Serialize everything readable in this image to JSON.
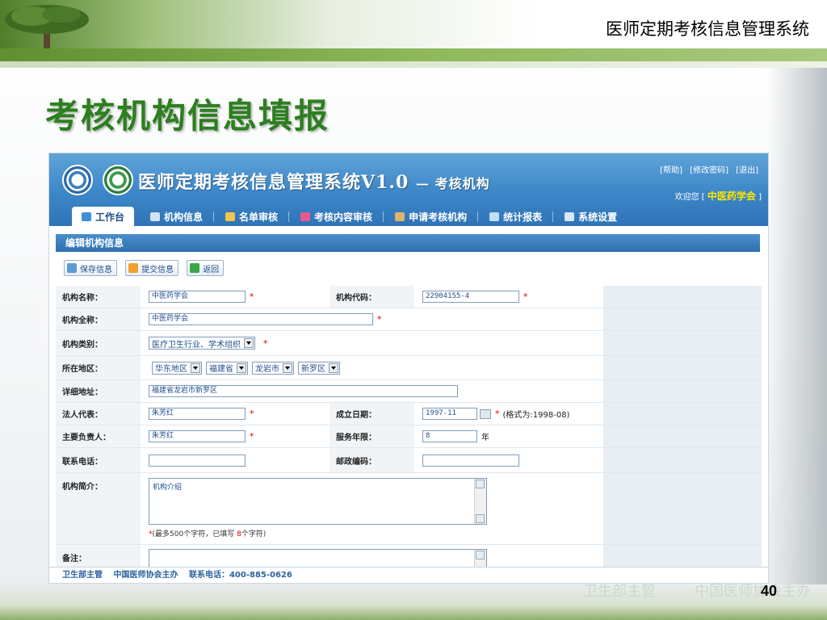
{
  "slide": {
    "system_title": "医师定期考核信息管理系统",
    "heading": "考核机构信息填报",
    "page_number": "40",
    "watermark_left": "卫生部主管",
    "watermark_right": "中国医师协会主办"
  },
  "app": {
    "title": "医师定期考核信息管理系统V1.0",
    "subtitle": "— 考核机构",
    "links": {
      "help": "[帮助]",
      "change_password": "[修改密码]",
      "logout": "[退出]"
    },
    "welcome_prefix": "欢迎您 [",
    "welcome_user": "中医药学会",
    "welcome_suffix": "]",
    "nav": [
      "工作台",
      "机构信息",
      "名单审核",
      "考核内容审核",
      "申请考核机构",
      "统计报表",
      "系统设置"
    ],
    "section_title": "编辑机构信息",
    "buttons": {
      "save": "保存信息",
      "submit": "提交信息",
      "back": "返回"
    },
    "form": {
      "org_name_label": "机构名称：",
      "org_name": "中医药学会",
      "org_code_label": "机构代码：",
      "org_code": "22904155-4",
      "full_name_label": "机构全称：",
      "full_name": "中医药学会",
      "category_label": "机构类别：",
      "category": "医疗卫生行业、学术组织",
      "region_label": "所在地区：",
      "region": [
        "华东地区",
        "福建省",
        "龙岩市",
        "新罗区"
      ],
      "address_label": "详细地址：",
      "address": "福建省龙岩市新罗区",
      "legal_rep_label": "法人代表：",
      "legal_rep": "朱芳红",
      "founded_label": "成立日期：",
      "founded": "1997-11",
      "founded_hint": "(格式为:1998-08)",
      "principal_label": "主要负责人：",
      "principal": "朱芳红",
      "service_years_label": "服务年限：",
      "service_years": "8",
      "service_years_unit": "年",
      "phone_label": "联系电话：",
      "phone": "",
      "postcode_label": "邮政编码：",
      "postcode": "",
      "intro_label": "机构简介：",
      "intro": "机构介绍",
      "intro_hint_prefix": "(最多500个字符，已填写 ",
      "intro_hint_count": "8",
      "intro_hint_suffix": "个字符)",
      "remark_label": "备注：",
      "remark": "",
      "required_mark": "*"
    },
    "footer": [
      "卫生部主管",
      "中国医师协会主办",
      "联系电话：400-885-0626"
    ]
  },
  "colors": {
    "heading_green": "#2d7f1f",
    "header_blue": "#3c86c8",
    "welcome_yellow": "#ffe600",
    "required_red": "#e00000"
  }
}
